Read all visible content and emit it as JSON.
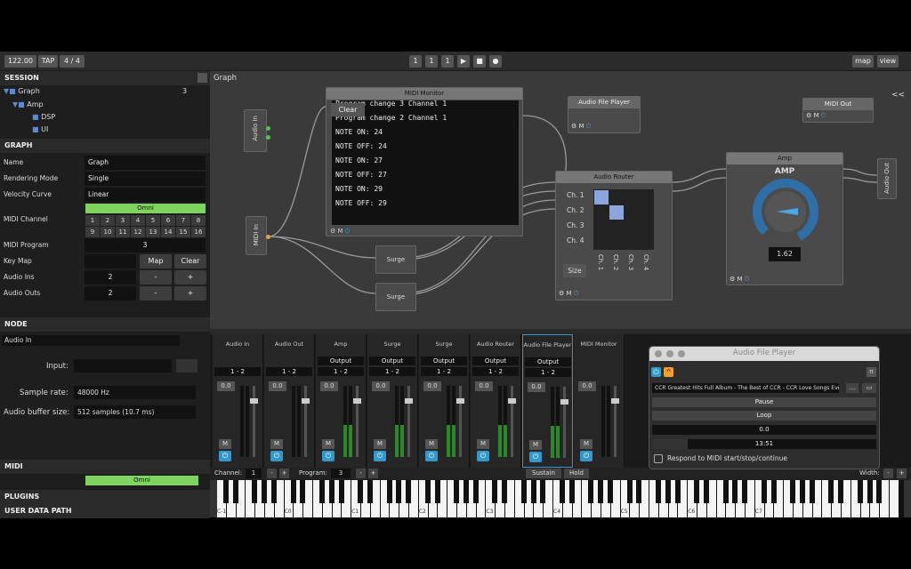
{
  "toolbar": {
    "tempo": "122.00",
    "tap": "TAP",
    "sig": "4 / 4",
    "t1": "1",
    "t2": "1",
    "t3": "1",
    "play": "▶",
    "stop": "■",
    "rec": "●",
    "map": "map",
    "view": "view"
  },
  "session": {
    "header": "SESSION",
    "items": [
      {
        "label": "Graph",
        "count": "3"
      },
      {
        "label": "Amp"
      },
      {
        "label": "DSP"
      },
      {
        "label": "UI"
      }
    ]
  },
  "graph_panel": {
    "header": "GRAPH",
    "name_label": "Name",
    "name": "Graph",
    "render_label": "Rendering Mode",
    "render": "Single",
    "velocity_label": "Velocity Curve",
    "velocity": "Linear",
    "midi_channel_label": "MIDI Channel",
    "omni": "Omni",
    "channels": [
      "1",
      "2",
      "3",
      "4",
      "5",
      "6",
      "7",
      "8",
      "9",
      "10",
      "11",
      "12",
      "13",
      "14",
      "15",
      "16"
    ],
    "midi_program_label": "MIDI Program",
    "midi_program": "3",
    "keymap_label": "Key Map",
    "map": "Map",
    "clear": "Clear",
    "ins_label": "Audio Ins",
    "ins": "2",
    "outs_label": "Audio Outs",
    "outs": "2",
    "minus": "-",
    "plus": "+"
  },
  "node_panel": {
    "header": "NODE",
    "node": "Audio In",
    "input_label": "Input:",
    "rate_label": "Sample rate:",
    "rate": "48000 Hz",
    "buffer_label": "Audio buffer size:",
    "buffer": "512 samples (10.7 ms)"
  },
  "midi_panel": {
    "header": "MIDI",
    "omni": "Omni"
  },
  "plugins": "PLUGINS",
  "userdata": "USER DATA PATH",
  "graph": {
    "title": "Graph",
    "collapse": "<<"
  },
  "nodes": {
    "midi_monitor": {
      "title": "MIDI Monitor",
      "clear": "Clear",
      "lines": [
        "Program change 3 Channel 1",
        "Program change 2 Channel 1",
        "NOTE ON: 24",
        "NOTE OFF: 24",
        "NOTE ON: 27",
        "NOTE OFF: 27",
        "NOTE ON: 29",
        "NOTE OFF: 29"
      ]
    },
    "audio_file_player": {
      "title": "Audio File Player"
    },
    "midi_out": {
      "title": "MIDI Out"
    },
    "audio_router": {
      "title": "Audio Router",
      "rows": [
        "Ch. 1",
        "Ch. 2",
        "Ch. 3",
        "Ch. 4"
      ],
      "size": "Size"
    },
    "amp": {
      "title": "Amp",
      "label": "AMP",
      "value": "1.62"
    },
    "audio_in": "Audio In",
    "midi_in": "MIDI In",
    "audio_out": "Audio Out",
    "surge1": "Surge",
    "surge2": "Surge"
  },
  "mixer": {
    "strips": [
      {
        "name": "Audio In",
        "sel": "",
        "io": "1 - 2",
        "vol": "0.0"
      },
      {
        "name": "Audio Out",
        "sel": "",
        "io": "1 - 2",
        "vol": "0.0"
      },
      {
        "name": "Amp",
        "sel": "Output",
        "io": "1 - 2",
        "vol": "0.0"
      },
      {
        "name": "Surge",
        "sel": "Output",
        "io": "1 - 2",
        "vol": "0.0"
      },
      {
        "name": "Surge",
        "sel": "Output",
        "io": "1 - 2",
        "vol": "0.0"
      },
      {
        "name": "Audio Router",
        "sel": "Output",
        "io": "1 - 2",
        "vol": "0.0"
      },
      {
        "name": "Audio File Player",
        "sel": "Output",
        "io": "1 - 2",
        "vol": "0.0"
      },
      {
        "name": "MIDI Monitor",
        "sel": "",
        "io": "",
        "vol": "0.0"
      }
    ],
    "mute": "M"
  },
  "keyboard": {
    "channel_label": "Channel:",
    "channel": "1",
    "program_label": "Program:",
    "program": "3",
    "sustain": "Sustain",
    "hold": "Hold",
    "width_label": "Width:",
    "octaves": [
      "C-1",
      "C0",
      "C1",
      "C2",
      "C3",
      "C4",
      "C5",
      "C6",
      "C7"
    ]
  },
  "afp_window": {
    "title": "Audio File Player",
    "file": "CCR Greatest Hits Full Album - The Best of CCR - CCR Love Songs Ever [-UX...",
    "dots": "...",
    "pause": "Pause",
    "loop": "Loop",
    "position": "0.0",
    "time": "13:51",
    "respond": "Respond to MIDI start/stop/continue",
    "n": "n"
  }
}
